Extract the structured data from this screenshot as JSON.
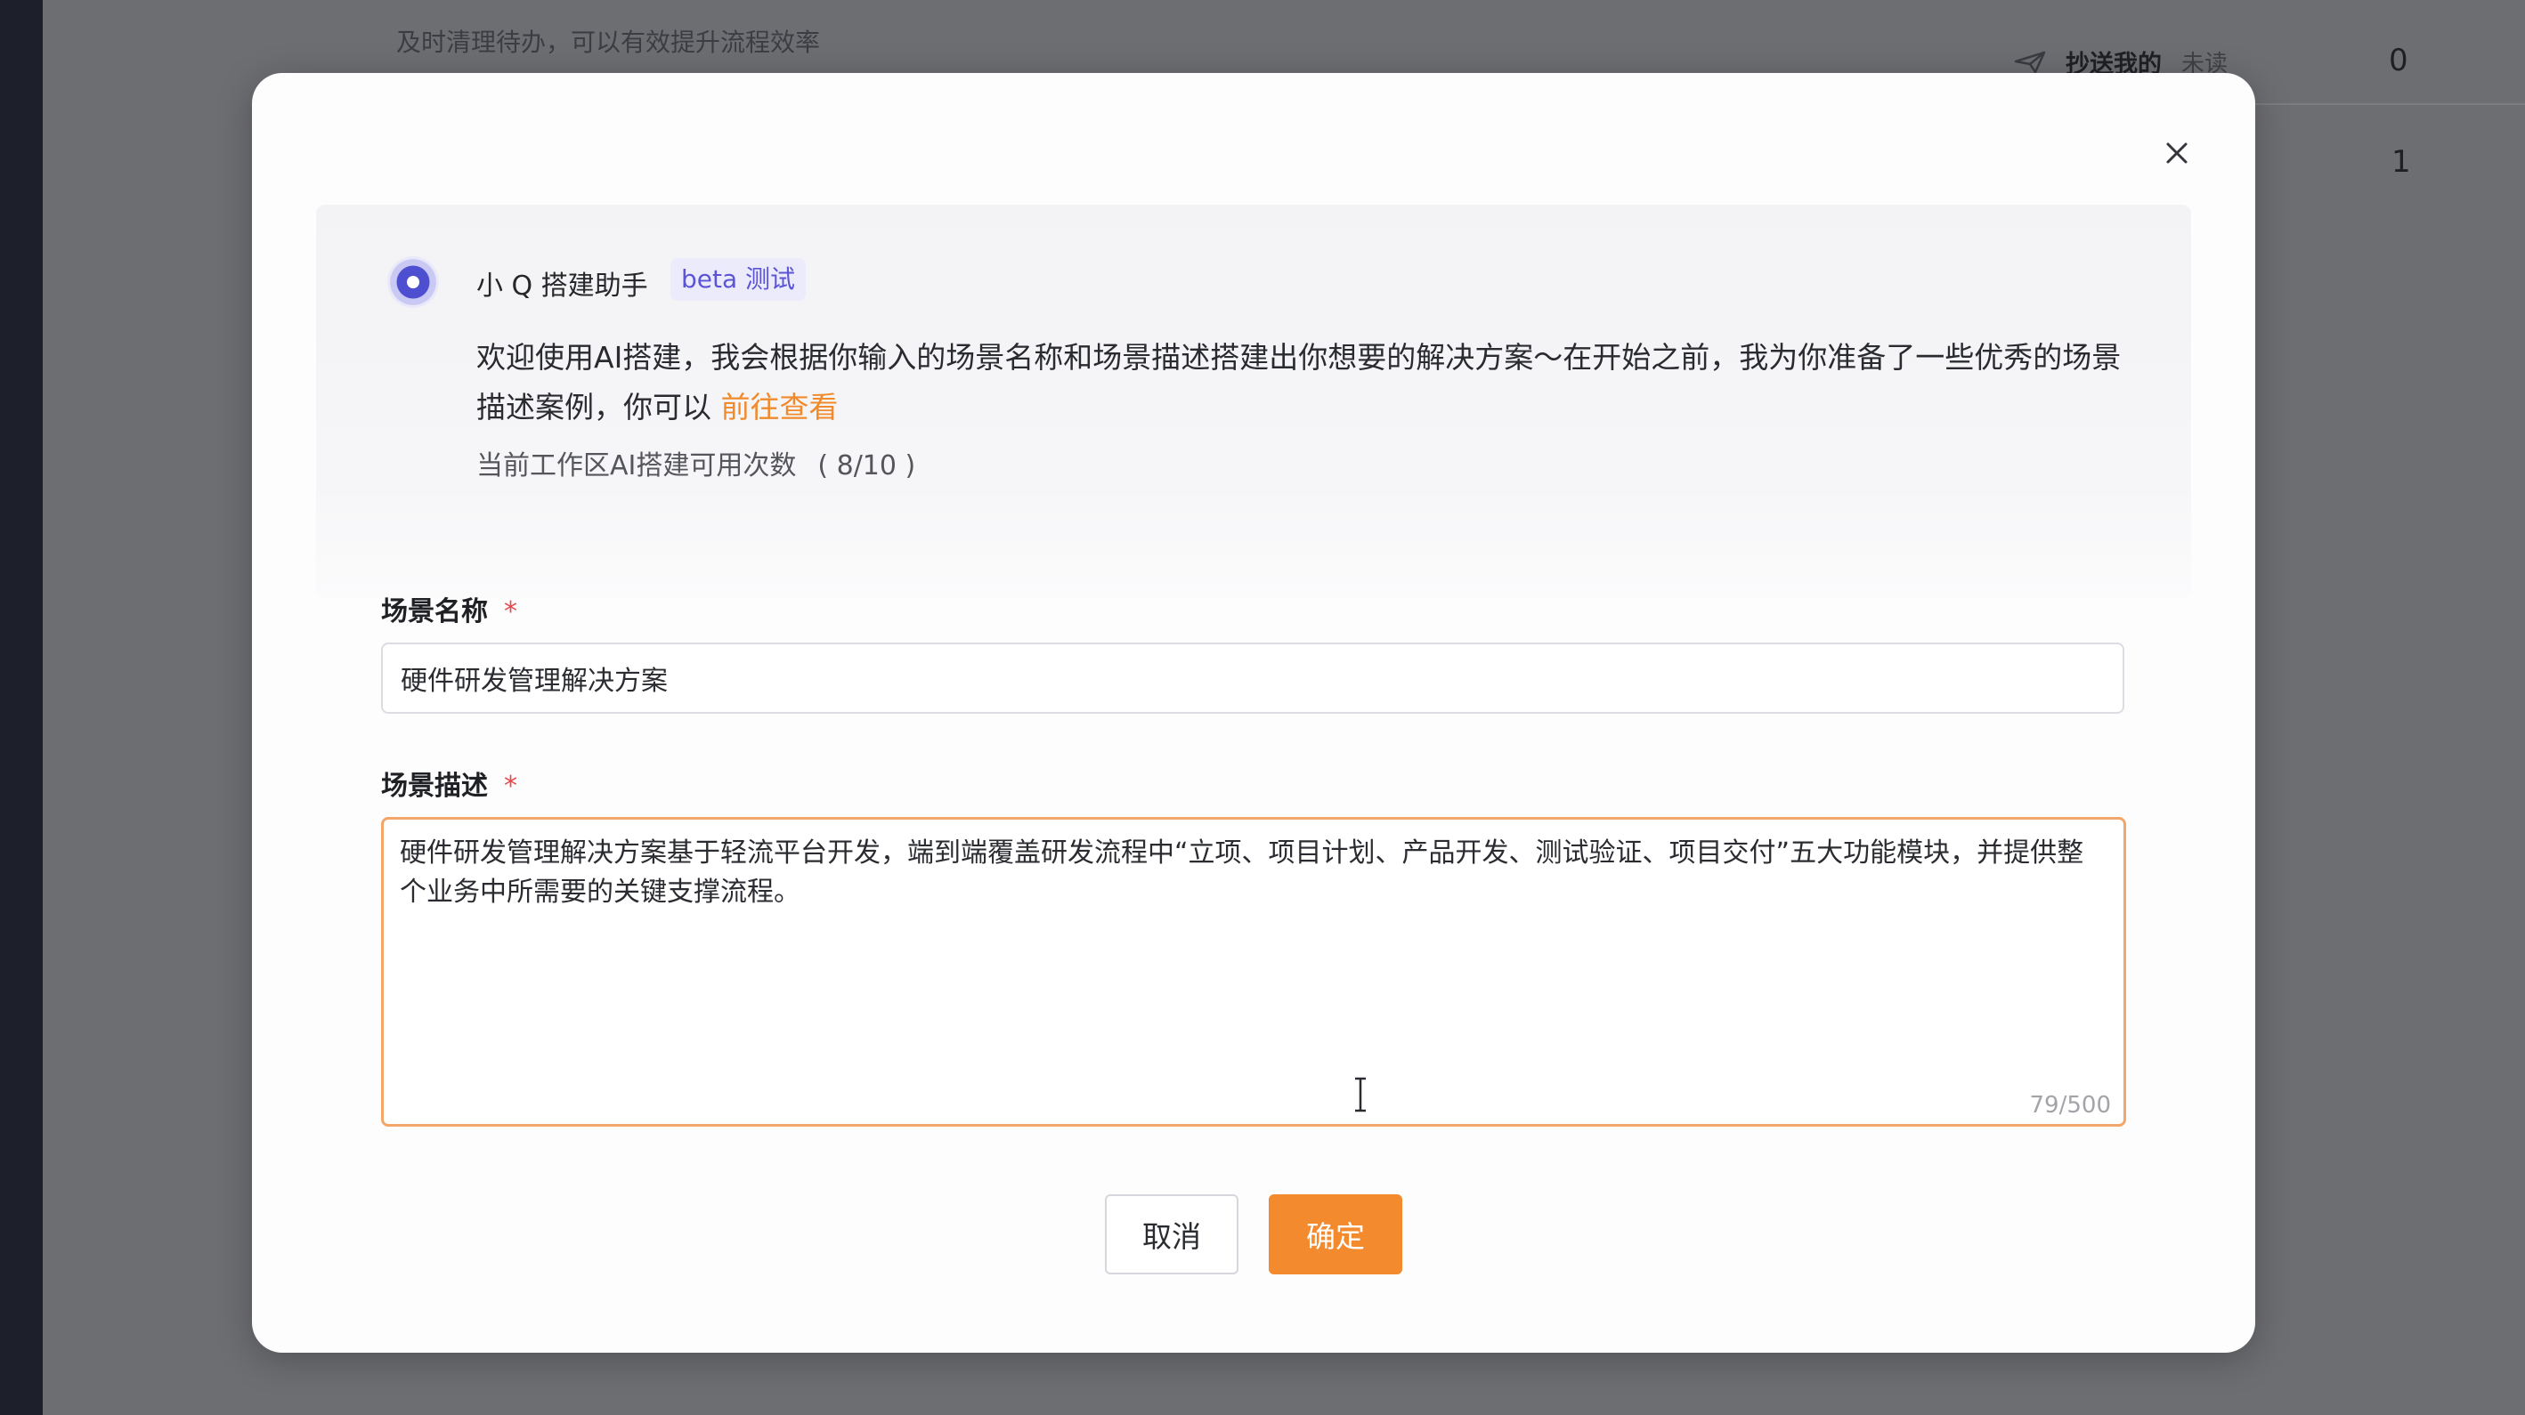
{
  "background": {
    "hint_text": "及时清理待办，可以有效提升流程效率",
    "cc_label": "抄送我的",
    "cc_sub": "未读",
    "count_a": "0",
    "count_b": "1"
  },
  "dialog": {
    "assistant_name": "小 Q 搭建助手",
    "badge": "beta 测试",
    "welcome_text": "欢迎使用AI搭建，我会根据你输入的场景名称和场景描述搭建出你想要的解决方案～在开始之前，我为你准备了一些优秀的场景描述案例，你可以 ",
    "welcome_link": "前往查看",
    "quota_label": "当前工作区AI搭建可用次数",
    "quota_value": "( 8/10 )",
    "name_label": "场景名称",
    "name_required": "*",
    "name_value": "硬件研发管理解决方案",
    "desc_label": "场景描述",
    "desc_required": "*",
    "desc_value": "硬件研发管理解决方案基于轻流平台开发，端到端覆盖研发流程中“立项、项目计划、产品开发、测试验证、项目交付”五大功能模块，并提供整个业务中所需要的关键支撑流程。",
    "desc_count": "79/500",
    "cancel_label": "取消",
    "ok_label": "确定"
  },
  "colors": {
    "accent": "#f38a2e",
    "badge_bg": "#ecebfb",
    "badge_text": "#5b55d6",
    "required": "#e5484d"
  },
  "icons": {
    "close": "close-icon",
    "avatar": "assistant-avatar-icon",
    "cc": "paper-plane-icon",
    "cursor": "text-cursor-icon"
  }
}
